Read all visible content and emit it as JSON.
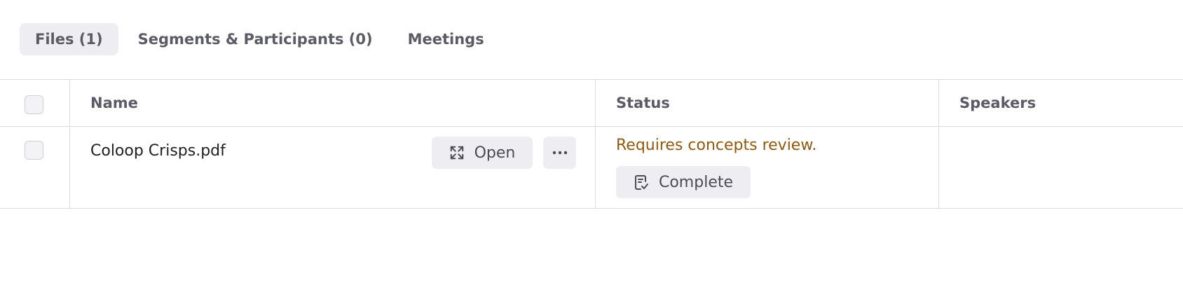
{
  "tabs": [
    {
      "label": "Files (1)",
      "active": true
    },
    {
      "label": "Segments & Participants (0)",
      "active": false
    },
    {
      "label": "Meetings",
      "active": false
    }
  ],
  "table": {
    "columns": [
      "Name",
      "Status",
      "Speakers"
    ],
    "rows": [
      {
        "name": "Coloop Crisps.pdf",
        "open_label": "Open",
        "status_message": "Requires concepts review.",
        "status_button_label": "Complete",
        "speakers": ""
      }
    ]
  },
  "icons": {
    "open": "expand-arrows-icon",
    "more": "more-horizontal-icon",
    "complete": "clipboard-check-icon"
  },
  "colors": {
    "active_tab_bg": "#eeedf1",
    "status_warning": "#8a5a12",
    "border": "#dcdce0"
  }
}
